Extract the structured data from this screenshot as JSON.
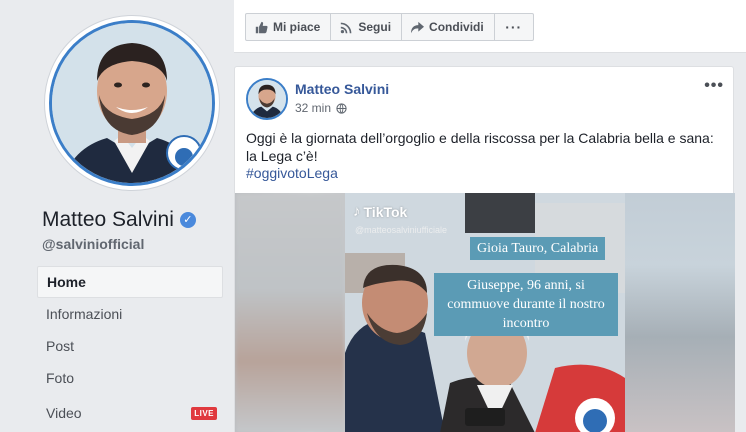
{
  "profile": {
    "name": "Matteo Salvini",
    "username": "@salviniofficial",
    "verified_icon": "check-icon",
    "accent_color": "#3b7ec8"
  },
  "nav": {
    "items": [
      {
        "label": "Home",
        "active": true
      },
      {
        "label": "Informazioni"
      },
      {
        "label": "Post"
      },
      {
        "label": "Foto"
      },
      {
        "label": "Video",
        "badge": "LIVE"
      }
    ]
  },
  "actions": {
    "like_label": "Mi piace",
    "follow_label": "Segui",
    "share_label": "Condividi",
    "more_label": "···"
  },
  "post": {
    "author": "Matteo Salvini",
    "time": "32 min",
    "more_label": "•••",
    "text": "Oggi è la giornata dell’orgoglio e della riscossa per la Calabria bella e sana: la Lega c’è!",
    "hashtag": "#oggivotoLega",
    "media": {
      "platform": "TikTok",
      "handle": "@matteosalviniufficiale",
      "location": "Gioia Tauro, Calabria",
      "caption": "Giuseppe, 96 anni, si commuove durante il nostro incontro"
    }
  }
}
